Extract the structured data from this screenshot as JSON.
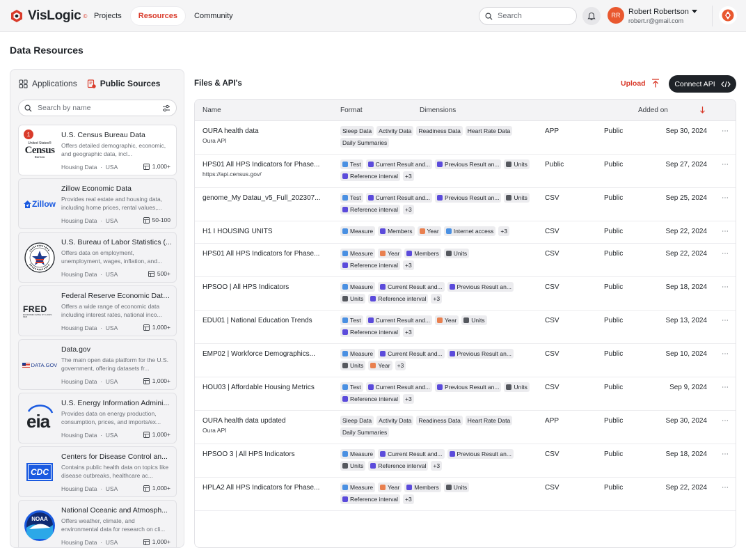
{
  "app": {
    "brand": "VisLogic",
    "brand_badge": "©",
    "nav": [
      {
        "label": "Projects",
        "active": false
      },
      {
        "label": "Resources",
        "active": true
      },
      {
        "label": "Community",
        "active": false
      }
    ],
    "search_placeholder": "Search",
    "user": {
      "initials": "RR",
      "name": "Robert Robertson",
      "email": "robert.r@gmail.com"
    },
    "accent_color": "#d93b2b"
  },
  "page": {
    "title": "Data Resources"
  },
  "left": {
    "tabs": [
      {
        "label": "Applications",
        "active": false,
        "icon": "applications-icon"
      },
      {
        "label": "Public Sources",
        "active": true,
        "icon": "public-sources-icon"
      }
    ],
    "search_placeholder": "Search by name",
    "sources": [
      {
        "title": "U.S. Census Bureau Data",
        "desc": "Offers detailed demographic, economic, and geographic data, incl...",
        "category": "Housing Data",
        "region": "USA",
        "count": "1,000+",
        "badge": "1",
        "logo": "census"
      },
      {
        "title": "Zillow Economic Data",
        "desc": "Provides real estate and housing data, including home prices, rental values,...",
        "category": "Housing Data",
        "region": "USA",
        "count": "50-100",
        "badge": "",
        "logo": "zillow"
      },
      {
        "title": "U.S. Bureau of Labor Statistics (...",
        "desc": "Offers data on employment, unemployment, wages, inflation, and...",
        "category": "Housing Data",
        "region": "USA",
        "count": "500+",
        "badge": "",
        "logo": "bls"
      },
      {
        "title": "Federal Reserve Economic Data...",
        "desc": "Offers a wide range of economic data including interest rates, national inco...",
        "category": "Housing Data",
        "region": "USA",
        "count": "1,000+",
        "badge": "",
        "logo": "fred"
      },
      {
        "title": "Data.gov",
        "desc": "The main open data platform for the U.S. government, offering datasets fr...",
        "category": "Housing Data",
        "region": "USA",
        "count": "1,000+",
        "badge": "",
        "logo": "datagov"
      },
      {
        "title": "U.S. Energy Information Admini...",
        "desc": "Provides data on energy production, consumption, prices, and imports/ex...",
        "category": "Housing Data",
        "region": "USA",
        "count": "1,000+",
        "badge": "",
        "logo": "eia"
      },
      {
        "title": "Centers for Disease Control an...",
        "desc": "Contains public health data on topics like disease outbreaks, healthcare ac...",
        "category": "Housing Data",
        "region": "USA",
        "count": "1,000+",
        "badge": "",
        "logo": "cdc"
      },
      {
        "title": "National Oceanic and Atmosph...",
        "desc": "Offers weather, climate, and environmental data for research on cli...",
        "category": "Housing Data",
        "region": "USA",
        "count": "1,000+",
        "badge": "",
        "logo": "noaa"
      }
    ],
    "logo_text": {
      "census_top": "United States®",
      "census_main": "Census",
      "census_sub": "Bureau",
      "zillow": "Zillow",
      "fred": "FRED",
      "fred_sub": "ECONOMIC DATA | ST. LOUIS FED",
      "datagov": "DATA.GOV",
      "eia": "eia",
      "cdc": "CDC",
      "noaa": "NOAA"
    }
  },
  "files": {
    "title": "Files & API's",
    "upload_label": "Upload",
    "connect_label": "Connect API",
    "columns": {
      "name": "Name",
      "format": "Format",
      "dimensions": "Dimensions",
      "added_on": "Added on"
    },
    "rows": [
      {
        "name": "OURA health data",
        "sub": "Oura API",
        "tags": [
          {
            "label": "Sleep Data",
            "ic": ""
          },
          {
            "label": "Activity Data",
            "ic": ""
          },
          {
            "label": "Readiness Data",
            "ic": ""
          },
          {
            "label": "Heart Rate Data",
            "ic": ""
          },
          {
            "label": "Daily Summaries",
            "ic": ""
          }
        ],
        "more": "",
        "format": "APP",
        "access": "Public",
        "date": "Sep 30, 2024"
      },
      {
        "name": "HPS01 All HPS Indicators for Phase...",
        "sub": "https://api.census.gov/",
        "tags": [
          {
            "label": "Test",
            "ic": "text"
          },
          {
            "label": "Current Result and...",
            "ic": "ref"
          },
          {
            "label": "Previous Result an...",
            "ic": "ref"
          },
          {
            "label": "Units",
            "ic": "unit"
          },
          {
            "label": "Reference interval",
            "ic": "ref"
          }
        ],
        "more": "+3",
        "format": "Public",
        "access": "Public",
        "date": "Sep 27, 2024"
      },
      {
        "name": "genome_My Datau_v5_Full_202307...",
        "sub": "",
        "tags": [
          {
            "label": "Test",
            "ic": "text"
          },
          {
            "label": "Current Result and...",
            "ic": "ref"
          },
          {
            "label": "Previous Result an...",
            "ic": "ref"
          },
          {
            "label": "Units",
            "ic": "unit"
          },
          {
            "label": "Reference interval",
            "ic": "ref"
          }
        ],
        "more": "+3",
        "format": "CSV",
        "access": "Public",
        "date": "Sep 25, 2024"
      },
      {
        "name": "H1 I HOUSING UNITS",
        "sub": "",
        "tags": [
          {
            "label": "Measure",
            "ic": "text"
          },
          {
            "label": "Members",
            "ic": "ref"
          },
          {
            "label": "Year",
            "ic": "date"
          },
          {
            "label": "Internet access",
            "ic": "text"
          }
        ],
        "more": "+3",
        "format": "CSV",
        "access": "Public",
        "date": "Sep 22, 2024"
      },
      {
        "name": "HPS01 All HPS Indicators for Phase...",
        "sub": "",
        "tags": [
          {
            "label": "Measure",
            "ic": "text"
          },
          {
            "label": "Year",
            "ic": "date"
          },
          {
            "label": "Members",
            "ic": "ref"
          },
          {
            "label": "Units",
            "ic": "unit"
          },
          {
            "label": "Reference interval",
            "ic": "ref"
          }
        ],
        "more": "+3",
        "format": "CSV",
        "access": "Public",
        "date": "Sep 22, 2024"
      },
      {
        "name": "HPSOO | All HPS Indicators",
        "sub": "",
        "tags": [
          {
            "label": "Measure",
            "ic": "text"
          },
          {
            "label": "Current Result and...",
            "ic": "ref"
          },
          {
            "label": "Previous Result an...",
            "ic": "ref"
          },
          {
            "label": "Units",
            "ic": "unit"
          },
          {
            "label": "Reference interval",
            "ic": "ref"
          }
        ],
        "more": "+3",
        "format": "CSV",
        "access": "Public",
        "date": "Sep 18, 2024"
      },
      {
        "name": "EDU01 | National Education Trends",
        "sub": "",
        "tags": [
          {
            "label": "Test",
            "ic": "text"
          },
          {
            "label": "Current Result and...",
            "ic": "ref"
          },
          {
            "label": "Year",
            "ic": "date"
          },
          {
            "label": "Units",
            "ic": "unit"
          },
          {
            "label": "Reference interval",
            "ic": "ref"
          }
        ],
        "more": "+3",
        "format": "CSV",
        "access": "Public",
        "date": "Sep 13, 2024"
      },
      {
        "name": "EMP02 | Workforce Demographics...",
        "sub": "",
        "tags": [
          {
            "label": "Measure",
            "ic": "text"
          },
          {
            "label": "Current Result and...",
            "ic": "ref"
          },
          {
            "label": "Previous Result an...",
            "ic": "ref"
          },
          {
            "label": "Units",
            "ic": "unit"
          },
          {
            "label": "Year",
            "ic": "date"
          }
        ],
        "more": "+3",
        "format": "CSV",
        "access": "Public",
        "date": "Sep 10, 2024"
      },
      {
        "name": "HOU03 | Affordable Housing Metrics",
        "sub": "",
        "tags": [
          {
            "label": "Test",
            "ic": "text"
          },
          {
            "label": "Current Result and...",
            "ic": "ref"
          },
          {
            "label": "Previous Result an...",
            "ic": "ref"
          },
          {
            "label": "Units",
            "ic": "unit"
          },
          {
            "label": "Reference interval",
            "ic": "ref"
          }
        ],
        "more": "+3",
        "format": "CSV",
        "access": "Public",
        "date": "Sep 9, 2024"
      },
      {
        "name": "OURA health data updated",
        "sub": "Oura API",
        "tags": [
          {
            "label": "Sleep Data",
            "ic": ""
          },
          {
            "label": "Activity Data",
            "ic": ""
          },
          {
            "label": "Readiness Data",
            "ic": ""
          },
          {
            "label": "Heart Rate Data",
            "ic": ""
          },
          {
            "label": "Daily Summaries",
            "ic": ""
          }
        ],
        "more": "",
        "format": "APP",
        "access": "Public",
        "date": "Sep 30, 2024"
      },
      {
        "name": "HPSOO 3 | All HPS Indicators",
        "sub": "",
        "tags": [
          {
            "label": "Measure",
            "ic": "text"
          },
          {
            "label": "Current Result and...",
            "ic": "ref"
          },
          {
            "label": "Previous Result an...",
            "ic": "ref"
          },
          {
            "label": "Units",
            "ic": "unit"
          },
          {
            "label": "Reference interval",
            "ic": "ref"
          }
        ],
        "more": "+3",
        "format": "CSV",
        "access": "Public",
        "date": "Sep 18, 2024"
      },
      {
        "name": "HPLA2 All HPS Indicators for Phase...",
        "sub": "",
        "tags": [
          {
            "label": "Measure",
            "ic": "text"
          },
          {
            "label": "Year",
            "ic": "date"
          },
          {
            "label": "Members",
            "ic": "ref"
          },
          {
            "label": "Units",
            "ic": "unit"
          },
          {
            "label": "Reference interval",
            "ic": "ref"
          }
        ],
        "more": "+3",
        "format": "CSV",
        "access": "Public",
        "date": "Sep 22, 2024"
      }
    ],
    "tag_icon_colors": {
      "text": "#4a90e2",
      "ref": "#5b4bdb",
      "unit": "#55585e",
      "date": "#e9804f"
    }
  }
}
